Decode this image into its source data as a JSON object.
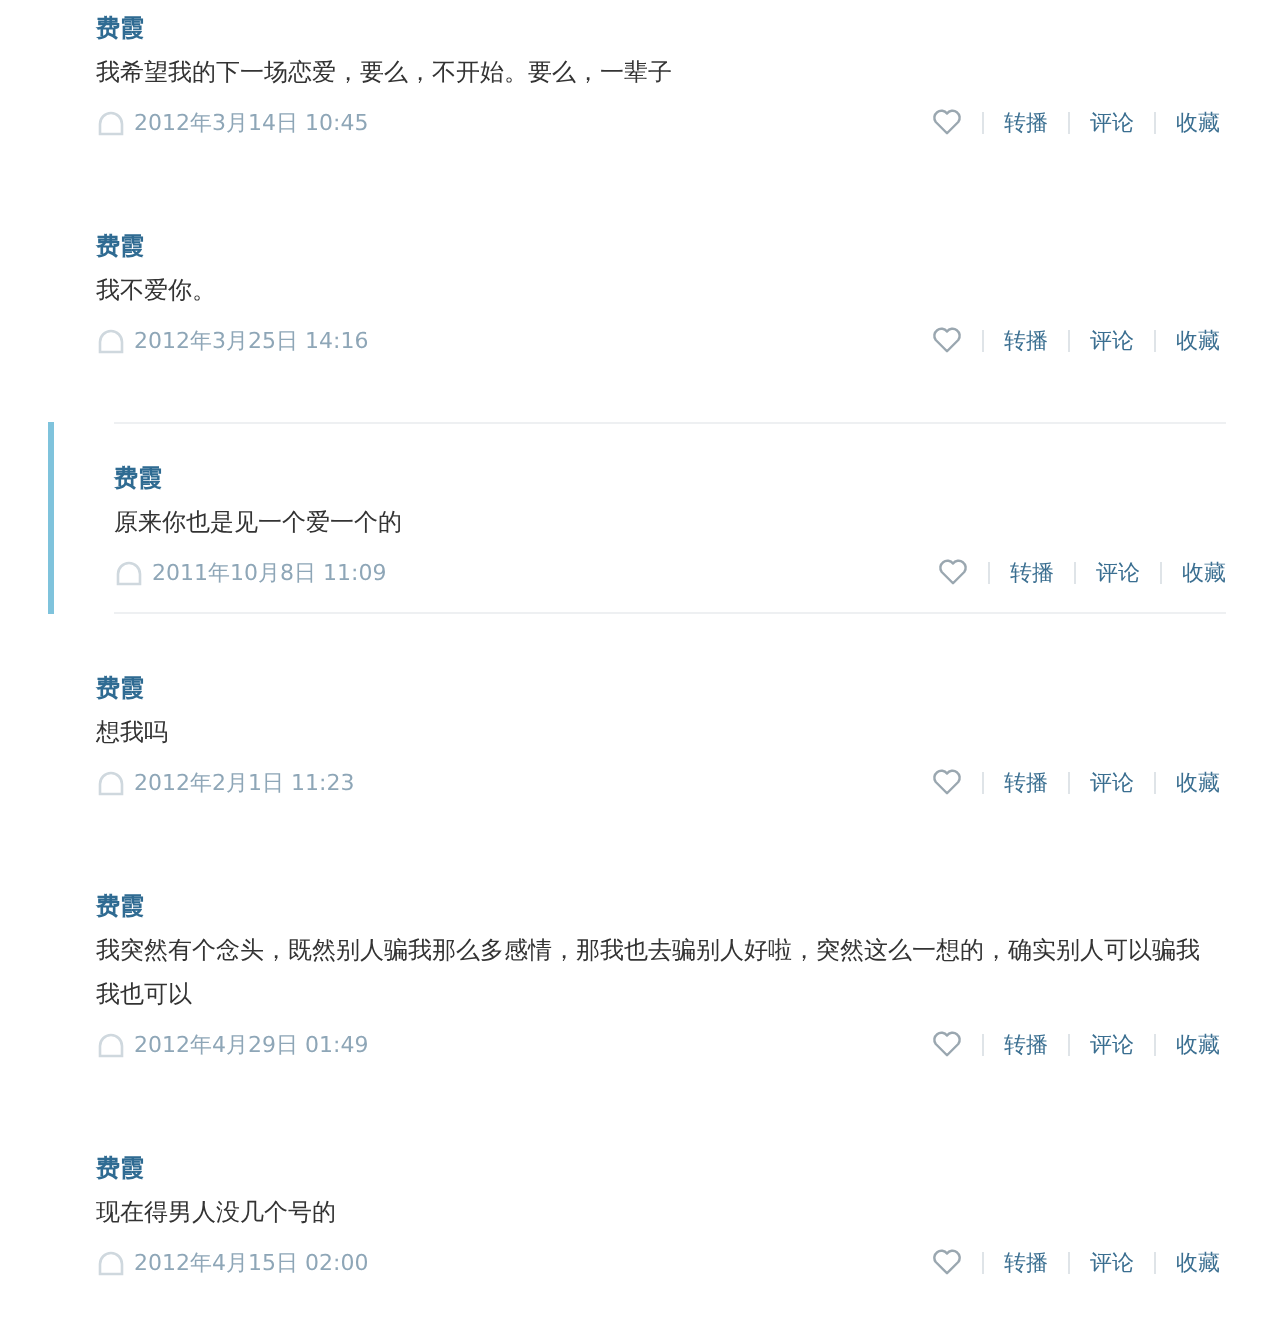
{
  "posts": [
    {
      "author": "费霞",
      "text": "我希望我的下一场恋爱，要么，不开始。要么，一辈子",
      "time": "2012年3月14日 10:45",
      "highlighted": false,
      "actions": [
        "转播",
        "评论",
        "收藏"
      ]
    },
    {
      "author": "费霞",
      "text": "我不爱你。",
      "time": "2012年3月25日 14:16",
      "highlighted": false,
      "actions": [
        "转播",
        "评论",
        "收藏"
      ]
    },
    {
      "author": "费霞",
      "text": "原来你也是见一个爱一个的",
      "time": "2011年10月8日 11:09",
      "highlighted": true,
      "actions": [
        "转播",
        "评论",
        "收藏"
      ]
    },
    {
      "author": "费霞",
      "text": "想我吗",
      "time": "2012年2月1日 11:23",
      "highlighted": false,
      "actions": [
        "转播",
        "评论",
        "收藏"
      ]
    },
    {
      "author": "费霞",
      "text": "我突然有个念头，既然别人骗我那么多感情，那我也去骗别人好啦，突然这么一想的，确实别人可以骗我我也可以",
      "time": "2012年4月29日 01:49",
      "highlighted": false,
      "actions": [
        "转播",
        "评论",
        "收藏"
      ]
    },
    {
      "author": "费霞",
      "text": "现在得男人没几个号的",
      "time": "2012年4月15日 02:00",
      "highlighted": false,
      "actions": [
        "转播",
        "评论",
        "收藏"
      ]
    }
  ]
}
